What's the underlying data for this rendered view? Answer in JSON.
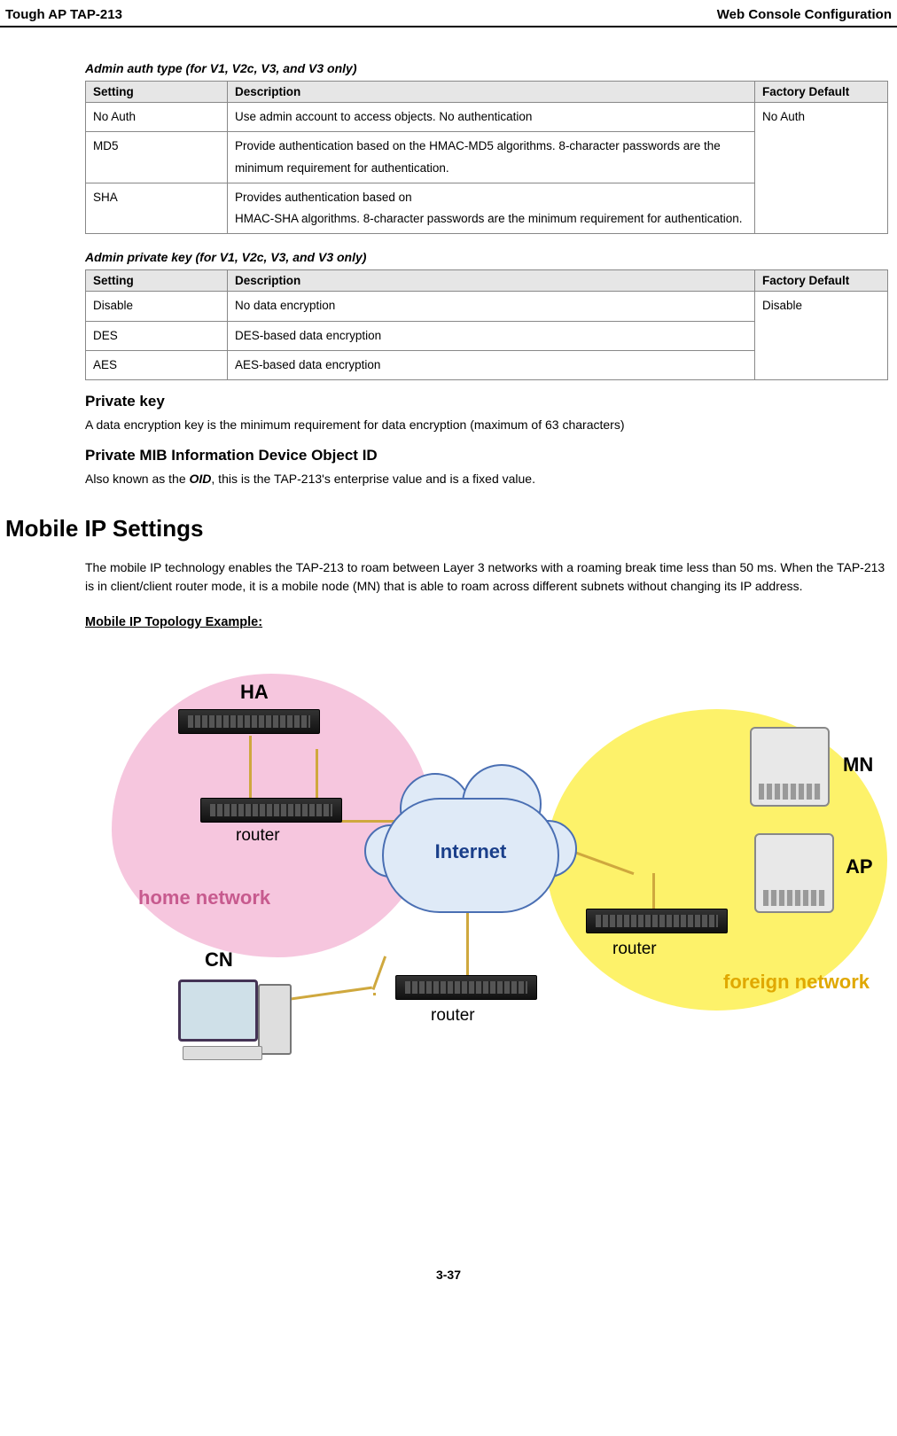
{
  "header": {
    "left": "Tough AP TAP-213",
    "right": "Web Console Configuration"
  },
  "table1": {
    "caption": "Admin auth type (for V1, V2c, V3, and V3 only)",
    "headers": [
      "Setting",
      "Description",
      "Factory Default"
    ],
    "rows": [
      {
        "setting": "No Auth",
        "desc": "Use admin account to access objects. No authentication"
      },
      {
        "setting": "MD5",
        "desc": "Provide authentication based on the HMAC-MD5 algorithms. 8-character passwords are the minimum requirement for authentication."
      },
      {
        "setting": "SHA",
        "desc": "Provides authentication based on\nHMAC-SHA algorithms. 8-character passwords are the minimum requirement for authentication."
      }
    ],
    "default": "No Auth"
  },
  "table2": {
    "caption": "Admin private key (for V1, V2c, V3, and V3 only)",
    "headers": [
      "Setting",
      "Description",
      "Factory Default"
    ],
    "rows": [
      {
        "setting": "Disable",
        "desc": "No data encryption"
      },
      {
        "setting": "DES",
        "desc": "DES-based data encryption"
      },
      {
        "setting": "AES",
        "desc": "AES-based data encryption"
      }
    ],
    "default": "Disable"
  },
  "sections": {
    "private_key_h": "Private key",
    "private_key_p": "A data encryption key is the minimum requirement for data encryption (maximum of 63 characters)",
    "mib_h": "Private MIB Information Device Object ID",
    "mib_p_pre": "Also known as the ",
    "mib_oid": "OID",
    "mib_p_post": ", this is the TAP-213's enterprise value and is a fixed value."
  },
  "mobile": {
    "h1": "Mobile IP Settings",
    "p": "The mobile IP technology enables the TAP-213 to roam between Layer 3 networks with a roaming break time less than 50 ms. When the TAP-213 is in client/client router mode, it is a mobile node (MN) that is able to roam across different subnets without changing its IP address.",
    "sub": "Mobile IP Topology Example:"
  },
  "diagram_labels": {
    "ha": "HA",
    "home": "home network",
    "cn": "CN",
    "internet": "Internet",
    "router1": "router",
    "router2": "router",
    "mn": "MN",
    "ap": "AP",
    "foreign": "foreign network"
  },
  "page_num": "3-37"
}
